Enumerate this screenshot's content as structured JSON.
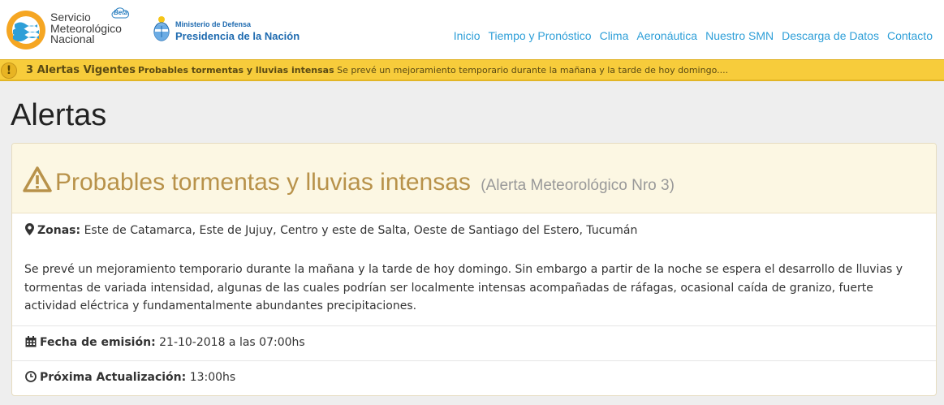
{
  "header": {
    "brand_line1": "Servicio",
    "brand_line2": "Meteorológico",
    "brand_line3": "Nacional",
    "beta_label": "Beta",
    "ministerio": "Ministerio de Defensa",
    "presidencia": "Presidencia de la Nación",
    "nav": [
      "Inicio",
      "Tiempo y Pronóstico",
      "Clima",
      "Aeronáutica",
      "Nuestro SMN",
      "Descarga de Datos",
      "Contacto"
    ]
  },
  "alert_bar": {
    "icon": "exclamation-icon",
    "count_label": "3 Alertas Vigentes",
    "summary_title": "Probables tormentas y lluvias intensas",
    "summary_text": "Se prevé un mejoramiento temporario durante la mañana y la tarde de hoy domingo...."
  },
  "page": {
    "title": "Alertas"
  },
  "alert": {
    "icon": "warning-triangle-icon",
    "title": "Probables tormentas y lluvias intensas",
    "subtitle": "(Alerta Meteorológico Nro 3)",
    "zonas_label": "Zonas:",
    "zonas_value": "Este de Catamarca, Este de Jujuy, Centro y este de Salta, Oeste de Santiago del Estero, Tucumán",
    "description": "Se prevé un mejoramiento temporario durante la mañana y la tarde de hoy domingo. Sin embargo a partir de la noche se espera el desarrollo de lluvias y tormentas de variada intensidad, algunas de las cuales podrían ser localmente intensas acompañadas de ráfagas, ocasional caída de granizo, fuerte actividad eléctrica y fundamentalmente abundantes precipitaciones.",
    "fecha_label": "Fecha de emisión:",
    "fecha_value": "21-10-2018 a las 07:00hs",
    "proxima_label": "Próxima Actualización:",
    "proxima_value": "13:00hs"
  },
  "colors": {
    "nav_link": "#2e9fd8",
    "alert_bar_bg": "#f7cc3b",
    "panel_head_bg": "#fcf7e3",
    "alert_title": "#b8924a"
  }
}
